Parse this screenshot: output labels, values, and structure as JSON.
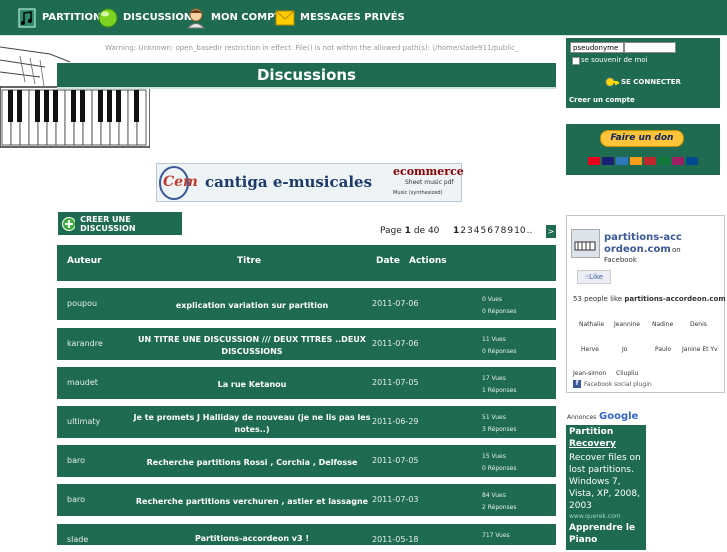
{
  "nav": {
    "items": [
      {
        "label": "PARTITIONS",
        "icon": "music-note-icon"
      },
      {
        "label": "DISCUSSIONS",
        "icon": "green-ball-icon"
      },
      {
        "label": "MON COMPTE",
        "icon": "user-icon"
      },
      {
        "label": "MESSAGES PRIVÉS",
        "icon": "envelope-icon"
      }
    ]
  },
  "header_strip": "Warning: Unknown: open_basedir restriction in effect. File() is not within the allowed path(s): (/home/slade911/public_",
  "page_title": "Discussions",
  "ad_banner": {
    "logo": "Cem",
    "brand": "cantiga e-musicales",
    "right_top": "ecommerce",
    "right_sub": "Sheet music pdf",
    "right_sub2": "Music (synthesized)"
  },
  "create_button": "CREER UNE DISCUSSION",
  "pagination": {
    "prefix": "Page",
    "current": "1",
    "of": "de",
    "total": "40",
    "pages": [
      "1",
      "2",
      "3",
      "4",
      "5",
      "6",
      "7",
      "8",
      "9",
      "10",
      ".."
    ],
    "next": ">"
  },
  "table": {
    "headers": {
      "author": "Auteur",
      "title": "Titre",
      "date": "Date",
      "actions": "Actions"
    },
    "rows": [
      {
        "author": "poupou",
        "title": "explication variation sur partition",
        "date": "2011-07-06",
        "views": "0 Vues",
        "replies": "0 Réponses"
      },
      {
        "author": "karandre",
        "title": "UN TITRE UNE DISCUSSION /// DEUX TITRES ..DEUX DISCUSSIONS",
        "date": "2011-07-06",
        "views": "11 Vues",
        "replies": "0 Réponses"
      },
      {
        "author": "maudet",
        "title": "La rue Ketanou",
        "date": "2011-07-05",
        "views": "17 Vues",
        "replies": "1 Réponses"
      },
      {
        "author": "ultimaty",
        "title": "Je te promets J Halliday de nouveau (je ne lis pas les notes..)",
        "date": "2011-06-29",
        "views": "51 Vues",
        "replies": "3 Réponses"
      },
      {
        "author": "baro",
        "title": "Recherche partitions Rossi , Corchia , Delfosse",
        "date": "2011-07-05",
        "views": "15 Vues",
        "replies": "0 Réponses"
      },
      {
        "author": "baro",
        "title": "Recherche partitions verchuren , astier et lassagne",
        "date": "2011-07-03",
        "views": "84 Vues",
        "replies": "2 Réponses"
      },
      {
        "author": "slade",
        "title": "Partitions-accordeon v3 !",
        "date": "2011-05-18",
        "views": "717 Vues",
        "replies": ""
      }
    ]
  },
  "login": {
    "username_value": "pseudonyme",
    "remember_label": "se souvenir de moi",
    "connect_label": "SE CONNECTER",
    "create_account": "Creer un compte"
  },
  "donate": {
    "button_label": "Faire un don"
  },
  "facebook": {
    "page_name": "partitions-accordeon.com",
    "on": "on",
    "network": "Facebook",
    "like_label": "Like",
    "likes_text_prefix": "53 people like",
    "likes_text_page": "partitions-accordeon.com",
    "fans": [
      "Nathalie",
      "Jeannine",
      "Nadine",
      "Denis",
      "Herve",
      "Jo",
      "Paulo",
      "Janine Et Yv",
      "Jean-simon",
      "Cliupliu"
    ],
    "plugin_label": "Facebook social plugin"
  },
  "google_ad": {
    "header": "Annonces",
    "brand": "Google",
    "link1": "Partition",
    "link1b": "Recovery",
    "text": "Recover files on lost partitions. Windows 7, Vista, XP, 2008, 2003",
    "url": "www.querek.com",
    "link2": "Apprendre le",
    "link2b": "Piano"
  },
  "colors": {
    "primary": "#1e6b52",
    "accent": "#ffcc00"
  }
}
